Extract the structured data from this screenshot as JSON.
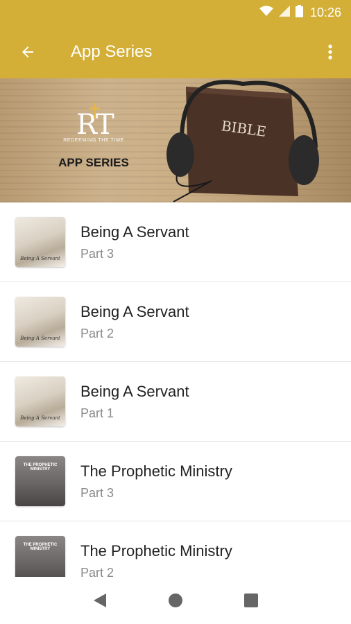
{
  "status_bar": {
    "time": "10:26",
    "wifi_icon": "wifi-icon",
    "signal_icon": "signal-icon",
    "battery_icon": "battery-icon"
  },
  "app_bar": {
    "title": "App Series",
    "back_icon": "arrow-back-icon",
    "menu_icon": "more-vert-icon"
  },
  "banner": {
    "tagline": "REDEEMING THE TIME",
    "label": "APP SERIES",
    "book_text": "BIBLE"
  },
  "items": [
    {
      "title": "Being A Servant",
      "subtitle": "Part 3",
      "thumb_text": "Being A Servant"
    },
    {
      "title": "Being A Servant",
      "subtitle": "Part 2",
      "thumb_text": "Being A Servant"
    },
    {
      "title": "Being A Servant",
      "subtitle": "Part 1",
      "thumb_text": "Being A Servant"
    },
    {
      "title": "The Prophetic Ministry",
      "subtitle": "Part 3",
      "thumb_text": "THE PROPHETIC MINISTRY"
    },
    {
      "title": "The Prophetic Ministry",
      "subtitle": "Part 2",
      "thumb_text": "THE PROPHETIC MINISTRY"
    }
  ],
  "nav_bar": {
    "back": "nav-back-icon",
    "home": "nav-home-icon",
    "recents": "nav-recents-icon"
  },
  "colors": {
    "primary": "#d4af37"
  }
}
